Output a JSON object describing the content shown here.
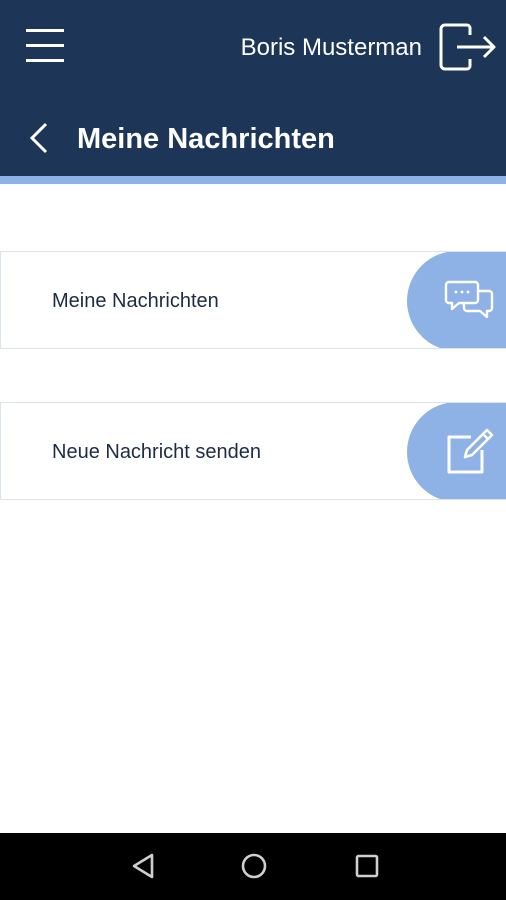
{
  "header": {
    "user_name": "Boris Musterman",
    "page_title": "Meine Nachrichten",
    "menu_icon": "hamburger-menu-icon",
    "logout_icon": "logout-icon",
    "back_icon": "chevron-left-icon"
  },
  "menu": {
    "items": [
      {
        "label": "Meine Nachrichten",
        "icon": "chat-bubbles-icon"
      },
      {
        "label": "Neue Nachricht senden",
        "icon": "compose-icon"
      }
    ]
  },
  "system_nav": {
    "back_icon": "nav-back-triangle-icon",
    "home_icon": "nav-home-circle-icon",
    "recent_icon": "nav-recent-square-icon"
  },
  "colors": {
    "header_bg": "#1d3557",
    "accent": "#8fb2e6",
    "text_dark": "#1d2b45",
    "nav_bg": "#000000"
  }
}
